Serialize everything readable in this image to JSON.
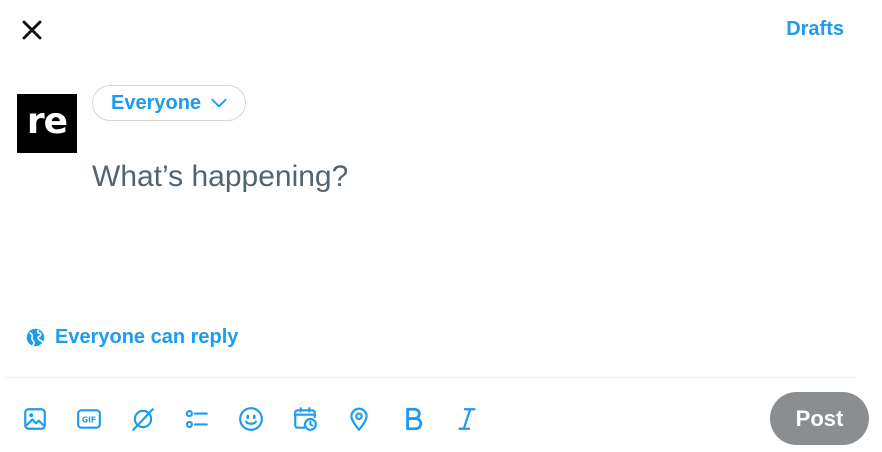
{
  "header": {
    "drafts_label": "Drafts"
  },
  "composer": {
    "avatar_text": "re",
    "audience_label": "Everyone",
    "placeholder": "What’s happening?",
    "reply_setting_label": "Everyone can reply"
  },
  "toolbar": {
    "tools": [
      "image-icon",
      "gif-icon",
      "grok-icon",
      "poll-icon",
      "emoji-icon",
      "schedule-icon",
      "location-icon",
      "bold-icon",
      "italic-icon"
    ],
    "post_label": "Post"
  },
  "colors": {
    "accent": "#1d9bf0",
    "post_disabled": "#8b8e91",
    "placeholder": "#536471"
  }
}
